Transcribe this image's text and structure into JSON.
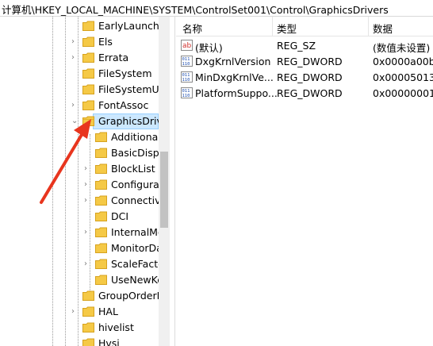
{
  "address_bar": {
    "path": "计算机\\HKEY_LOCAL_MACHINE\\SYSTEM\\ControlSet001\\Control\\GraphicsDrivers"
  },
  "tree": {
    "items": [
      {
        "label": "EarlyLaunch",
        "expandable": false
      },
      {
        "label": "Els",
        "expandable": true
      },
      {
        "label": "Errata",
        "expandable": true
      },
      {
        "label": "FileSystem",
        "expandable": false
      },
      {
        "label": "FileSystemUti",
        "expandable": false
      },
      {
        "label": "FontAssoc",
        "expandable": true
      },
      {
        "label": "GraphicsDriv",
        "expandable": true,
        "expanded": true,
        "selected": true
      },
      {
        "label": "Additional",
        "expandable": false
      },
      {
        "label": "BasicDispl",
        "expandable": false
      },
      {
        "label": "BlockList",
        "expandable": true
      },
      {
        "label": "Configurat",
        "expandable": true
      },
      {
        "label": "Connectivi",
        "expandable": true
      },
      {
        "label": "DCI",
        "expandable": false
      },
      {
        "label": "InternalMo",
        "expandable": true
      },
      {
        "label": "MonitorDa",
        "expandable": false
      },
      {
        "label": "ScaleFacto",
        "expandable": true
      },
      {
        "label": "UseNewKe",
        "expandable": false
      },
      {
        "label": "GroupOrderL",
        "expandable": false
      },
      {
        "label": "HAL",
        "expandable": true
      },
      {
        "label": "hivelist",
        "expandable": false
      },
      {
        "label": "Hvsi",
        "expandable": false
      }
    ]
  },
  "values_pane": {
    "columns": {
      "name": "名称",
      "type": "类型",
      "data": "数据"
    },
    "rows": [
      {
        "icon": "string-value-icon",
        "name": "(默认)",
        "type": "REG_SZ",
        "data": "(数值未设置)"
      },
      {
        "icon": "binary-value-icon",
        "name": "DxgKrnlVersion",
        "type": "REG_DWORD",
        "data": "0x0000a00b"
      },
      {
        "icon": "binary-value-icon",
        "name": "MinDxgKrnlVe...",
        "type": "REG_DWORD",
        "data": "0x00005013"
      },
      {
        "icon": "binary-value-icon",
        "name": "PlatformSuppo...",
        "type": "REG_DWORD",
        "data": "0x00000001"
      }
    ]
  },
  "colors": {
    "selection": "#cce8ff",
    "folder": "#f5c946",
    "annotation_arrow": "#e8351e"
  }
}
